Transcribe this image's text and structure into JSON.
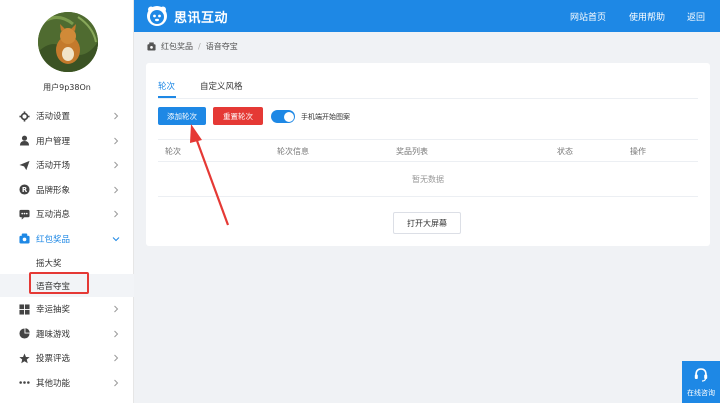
{
  "user": {
    "name": "用户9p38On"
  },
  "sidebar": {
    "items": [
      {
        "label": "活动设置",
        "icon": "gear-icon"
      },
      {
        "label": "用户管理",
        "icon": "user-icon"
      },
      {
        "label": "活动开场",
        "icon": "paper-plane-icon"
      },
      {
        "label": "品牌形象",
        "icon": "registered-icon"
      },
      {
        "label": "互动消息",
        "icon": "chat-icon"
      },
      {
        "label": "红包奖品",
        "icon": "gift-icon"
      },
      {
        "label": "幸运抽奖",
        "icon": "grid-icon"
      },
      {
        "label": "趣味游戏",
        "icon": "pie-icon"
      },
      {
        "label": "投票评选",
        "icon": "star-icon"
      },
      {
        "label": "其他功能",
        "icon": "more-icon"
      }
    ],
    "subitems": [
      "摇大奖",
      "语音夺宝"
    ]
  },
  "header": {
    "brand": "思讯互动",
    "nav": [
      "网站首页",
      "使用帮助",
      "返回"
    ]
  },
  "breadcrumb": {
    "parent": "红包奖品",
    "separator": "/",
    "current": "语音夺宝"
  },
  "tabs": [
    "轮次",
    "自定义风格"
  ],
  "actions": {
    "add_round": "添加轮次",
    "reset_round": "重置轮次",
    "toggle_label": "手机端开始图案"
  },
  "table": {
    "columns": [
      "轮次",
      "轮次信息",
      "奖品列表",
      "状态",
      "操作"
    ],
    "empty_text": "暂无数据"
  },
  "big_screen_button": "打开大屏幕",
  "support": {
    "label": "在线咨询"
  },
  "colors": {
    "primary": "#1e88e5",
    "danger": "#e53935"
  }
}
